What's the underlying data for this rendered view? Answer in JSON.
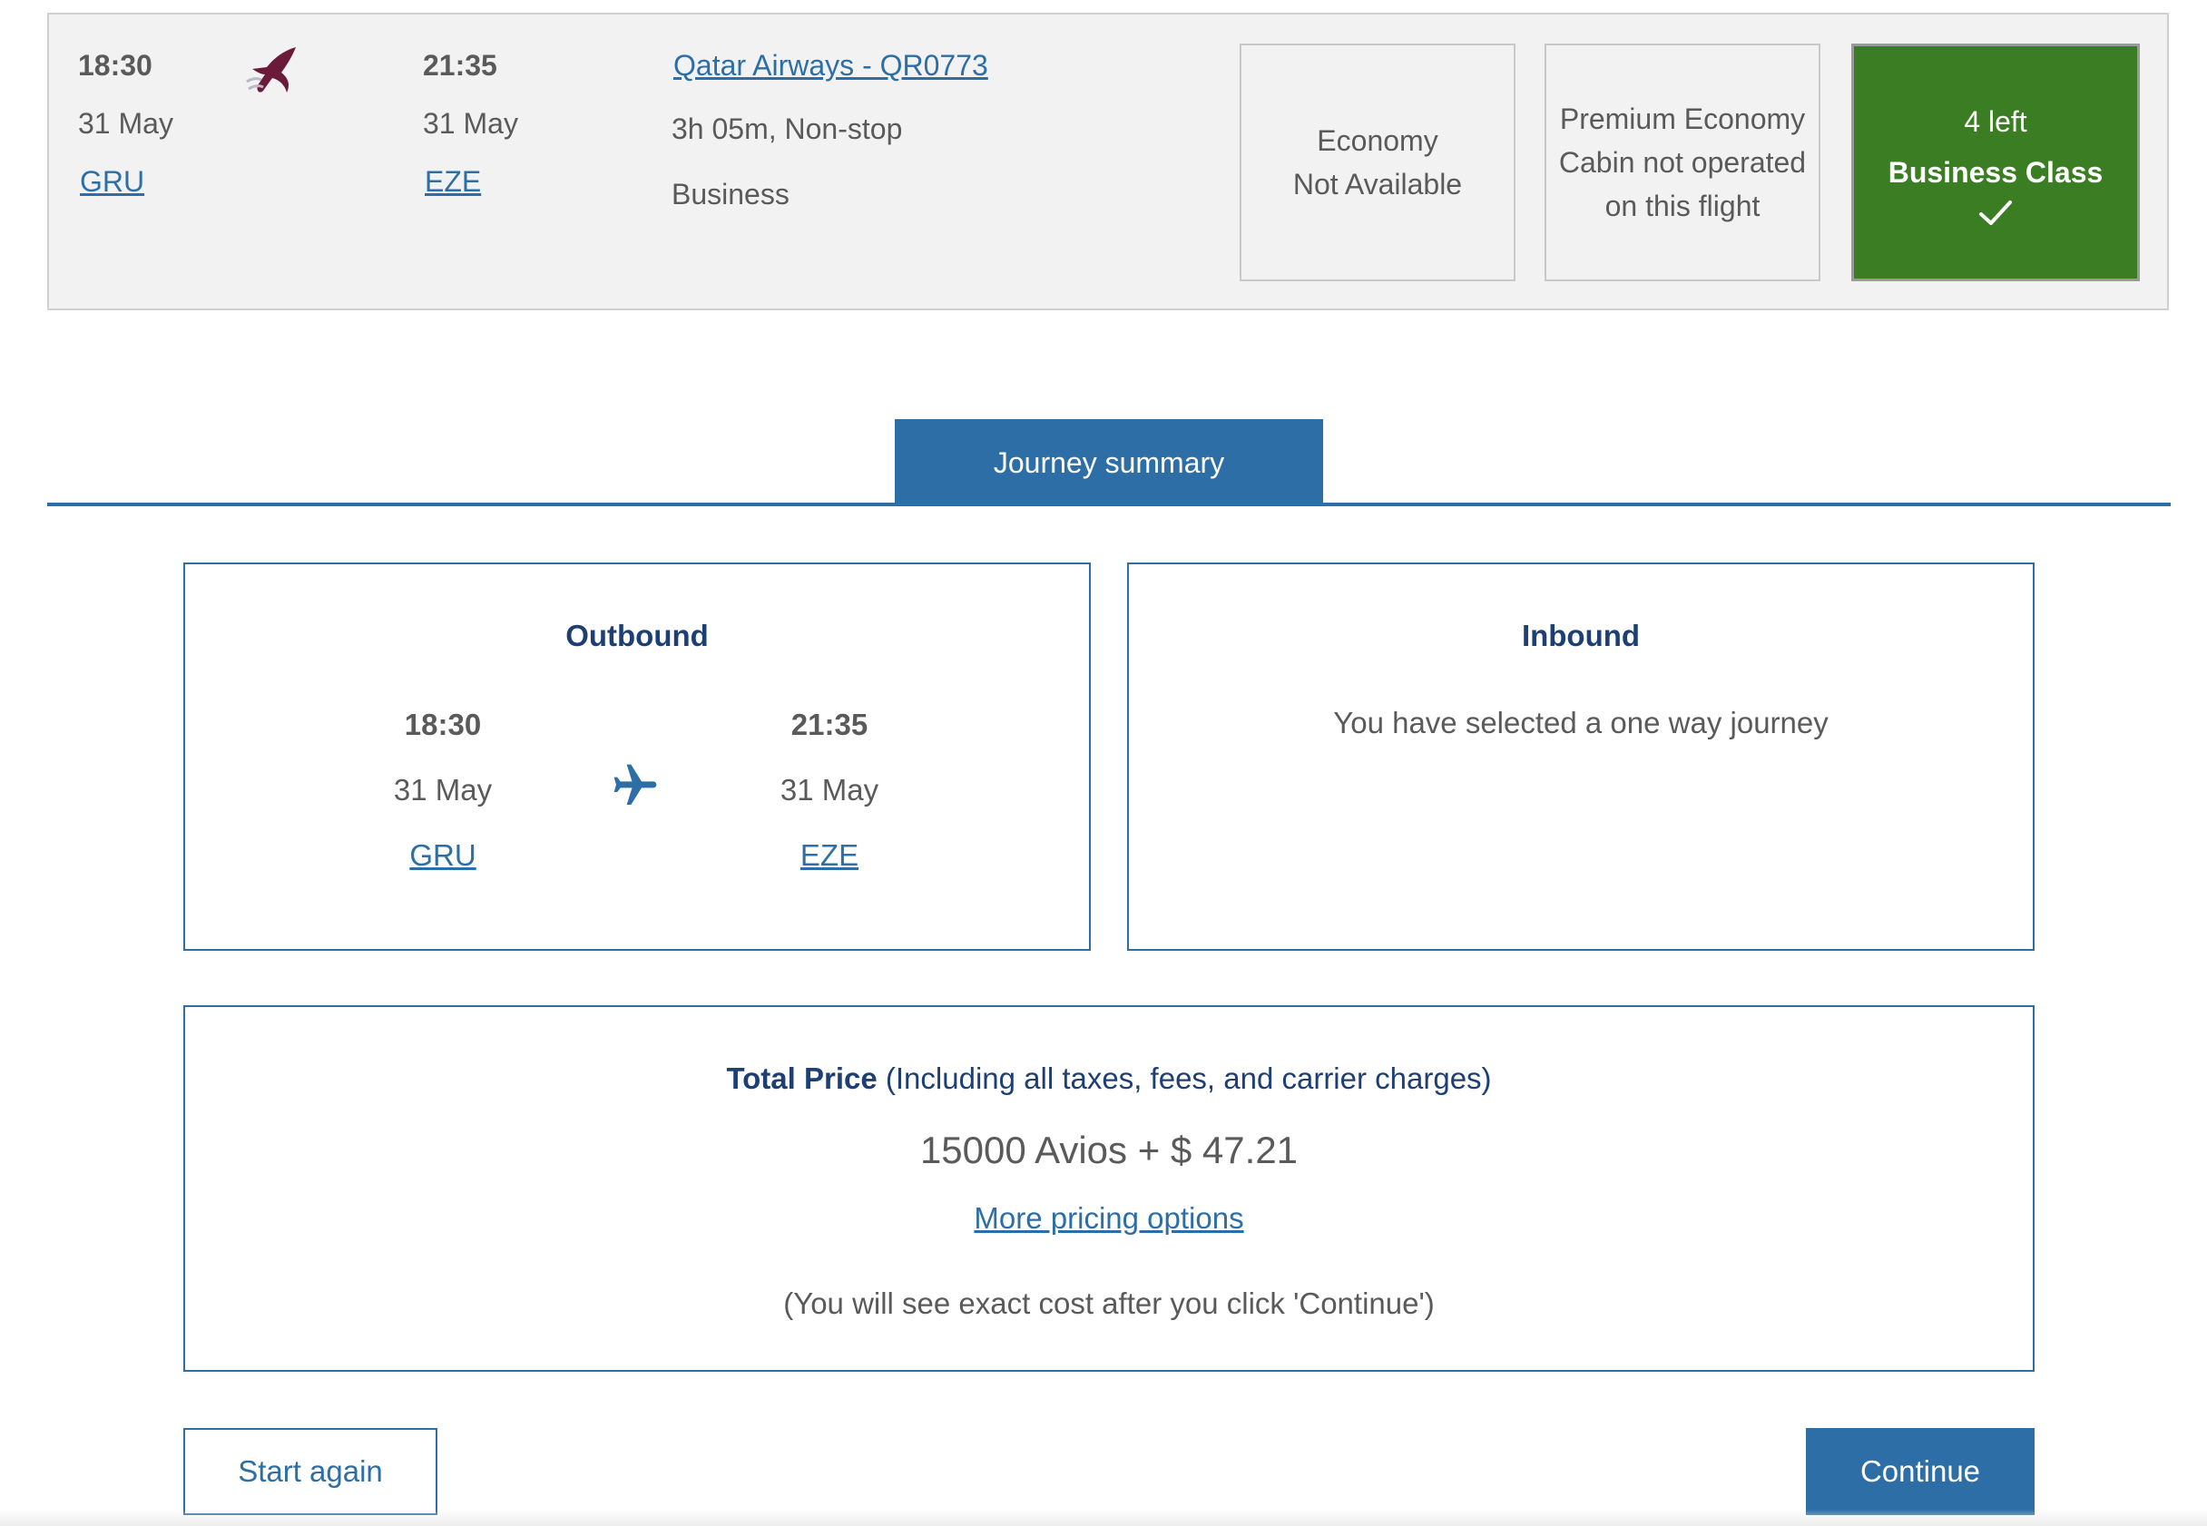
{
  "flight": {
    "depart_time": "18:30",
    "depart_date": "31 May",
    "depart_airport": "GRU",
    "arrive_time": "21:35",
    "arrive_date": "31 May",
    "arrive_airport": "EZE",
    "flight_link": "Qatar Airways - QR0773",
    "duration": "3h 05m, Non-stop",
    "cabin": "Business",
    "logo_icon": "qatar-airways-oryx-logo"
  },
  "cabins": {
    "economy": {
      "line1": "Economy",
      "line2": "Not Available"
    },
    "premium": {
      "line1": "Premium Economy",
      "line2": "Cabin not operated",
      "line3": "on this flight"
    },
    "business": {
      "seats_left": "4 left",
      "name": "Business Class",
      "status_icon": "checkmark-icon",
      "color": "#3a7d23"
    }
  },
  "summary_tab": {
    "label": "Journey summary"
  },
  "outbound": {
    "title": "Outbound",
    "depart_time": "18:30",
    "depart_date": "31 May",
    "depart_airport": "GRU",
    "arrive_time": "21:35",
    "arrive_date": "31 May",
    "arrive_airport": "EZE",
    "icon": "airplane-icon"
  },
  "inbound": {
    "title": "Inbound",
    "message": "You have selected a one way journey"
  },
  "price": {
    "label": "Total Price",
    "qualifier": "(Including all taxes, fees, and carrier charges)",
    "amount": "15000 Avios + $ 47.21",
    "more_link": "More pricing options",
    "note": "(You will see exact cost after you click 'Continue')"
  },
  "buttons": {
    "start_again": "Start again",
    "continue": "Continue"
  },
  "colors": {
    "accent": "#2e6ea6",
    "heading": "#1d3f73",
    "available": "#3a7d23"
  }
}
